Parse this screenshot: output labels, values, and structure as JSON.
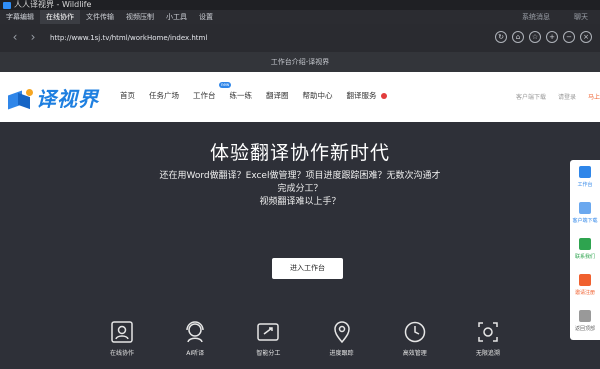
{
  "window": {
    "title": "人人译视界 - Wildlife"
  },
  "menubar": {
    "items": [
      "字幕编辑",
      "在线协作",
      "文件传输",
      "视频压制",
      "小工具",
      "设置"
    ],
    "active_index": 1,
    "right_items": [
      "系统消息",
      "聊天"
    ]
  },
  "addressbar": {
    "url": "http://www.1sj.tv/html/workHome/index.html",
    "icons": [
      "back-icon",
      "forward-icon",
      "refresh-icon",
      "home-icon",
      "favorite-icon",
      "zoom-in-icon",
      "zoom-out-icon",
      "close-icon"
    ]
  },
  "tab": {
    "title": "工作台介绍-译视界"
  },
  "site": {
    "logo_text": "译视界",
    "nav": [
      {
        "label": "首页",
        "icon": ""
      },
      {
        "label": "任务广场",
        "icon": ""
      },
      {
        "label": "工作台",
        "icon": "new-badge"
      },
      {
        "label": "练一练",
        "icon": ""
      },
      {
        "label": "翻译圈",
        "icon": ""
      },
      {
        "label": "帮助中心",
        "icon": ""
      },
      {
        "label": "翻译服务",
        "icon": "hot-icon"
      }
    ],
    "new_badge": "new",
    "header_links": [
      "客户端下载",
      "请登录",
      "马上"
    ]
  },
  "hero": {
    "title": "体验翻译协作新时代",
    "subtitle_lines": [
      "还在用Word做翻译？Excel做管理？项目进度跟踪困难？无数次沟通才",
      "完成分工？",
      "视频翻译难以上手？"
    ],
    "button": "进入工作台",
    "features": [
      {
        "label": "在线协作",
        "icon": "collab-icon"
      },
      {
        "label": "AI听译",
        "icon": "ai-listen-icon"
      },
      {
        "label": "智能分工",
        "icon": "smart-assign-icon"
      },
      {
        "label": "进度跟踪",
        "icon": "location-icon"
      },
      {
        "label": "高效管理",
        "icon": "clock-icon"
      },
      {
        "label": "无限追溯",
        "icon": "trace-icon"
      }
    ]
  },
  "side_panel": {
    "items": [
      {
        "label": "工作台",
        "icon": "workbench-icon"
      },
      {
        "label": "客户端下载",
        "icon": "download-icon"
      },
      {
        "label": "联系我们",
        "icon": "phone-icon"
      },
      {
        "label": "邀请注册",
        "icon": "invite-icon"
      },
      {
        "label": "返回顶部",
        "icon": "back-to-top-icon"
      }
    ]
  },
  "colors": {
    "brand": "#1e7fe0",
    "accent_orange": "#f0602e",
    "hero_bg": "#2e3038"
  }
}
